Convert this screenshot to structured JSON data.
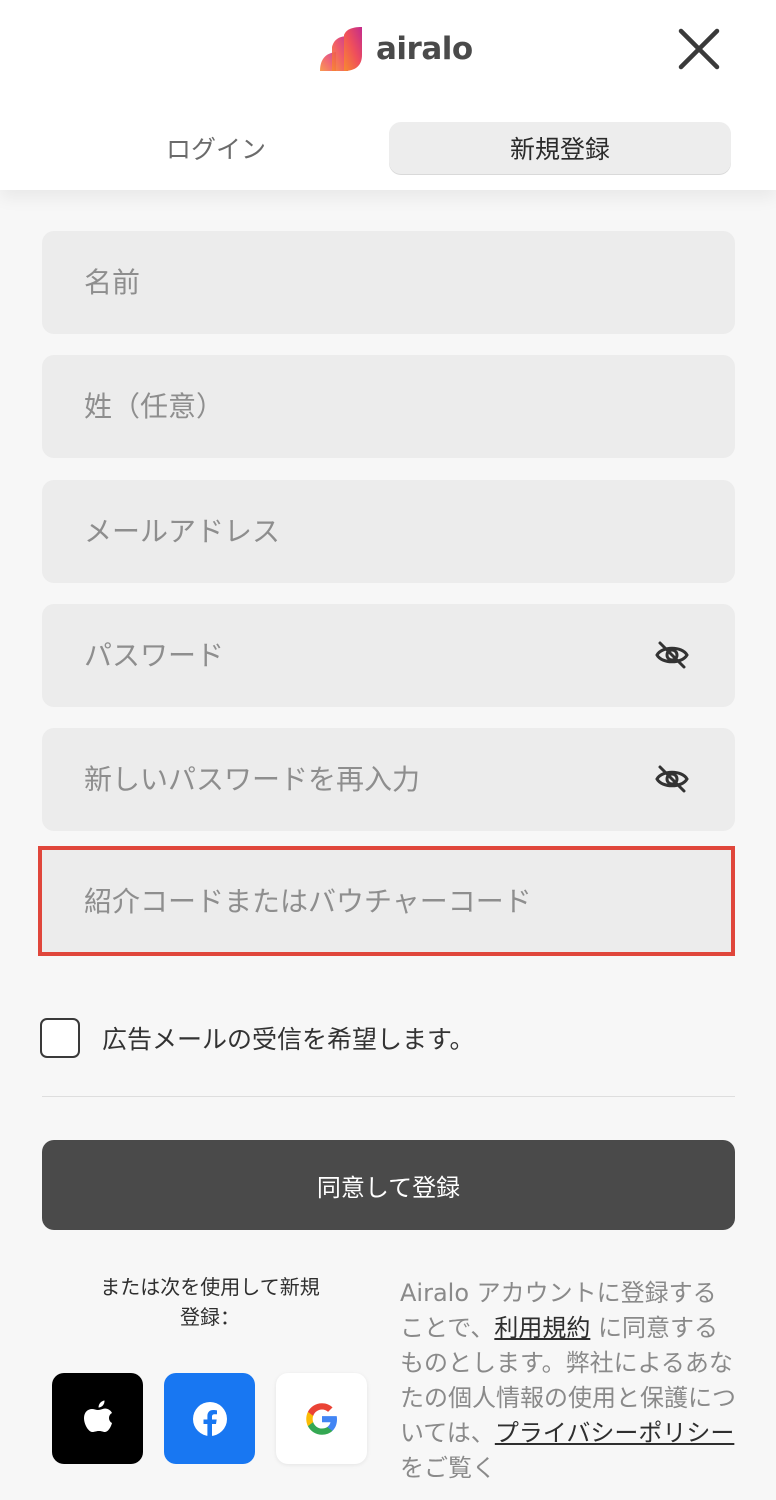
{
  "header": {
    "brand": "airalo",
    "close_icon": "close-icon",
    "tabs": [
      {
        "label": "ログイン",
        "active": false
      },
      {
        "label": "新規登録",
        "active": true
      }
    ]
  },
  "form": {
    "first_name": {
      "placeholder": "名前",
      "value": ""
    },
    "last_name": {
      "placeholder": "姓（任意）",
      "value": ""
    },
    "email": {
      "placeholder": "メールアドレス",
      "value": ""
    },
    "password": {
      "placeholder": "パスワード",
      "value": "",
      "icon": "eye-slash-icon"
    },
    "password_confirm": {
      "placeholder": "新しいパスワードを再入力",
      "value": "",
      "icon": "eye-slash-icon"
    },
    "referral": {
      "placeholder": "紹介コードまたはバウチャーコード",
      "value": "",
      "highlight_color": "#e0463b"
    },
    "marketing_opt_in": {
      "label": "広告メールの受信を希望します。",
      "checked": false
    },
    "submit_label": "同意して登録"
  },
  "social": {
    "caption_line1": "または次を使用して新規",
    "caption_line2": "登録：",
    "providers": [
      "apple-icon",
      "facebook-icon",
      "google-icon"
    ]
  },
  "terms": {
    "text_1": "Airalo アカウントに登録することで、",
    "link_terms": "利用規約",
    "text_2": " に同意するものとします。弊社によるあなたの個人情報の使用と保護については、",
    "link_privacy": "プライバシーポリシー",
    "text_3": " をご覧く"
  },
  "colors": {
    "brand_gradient_start": "#f5603b",
    "brand_gradient_end": "#c32b8c",
    "button_dark": "#4a4a4a",
    "facebook_blue": "#1877f2"
  }
}
